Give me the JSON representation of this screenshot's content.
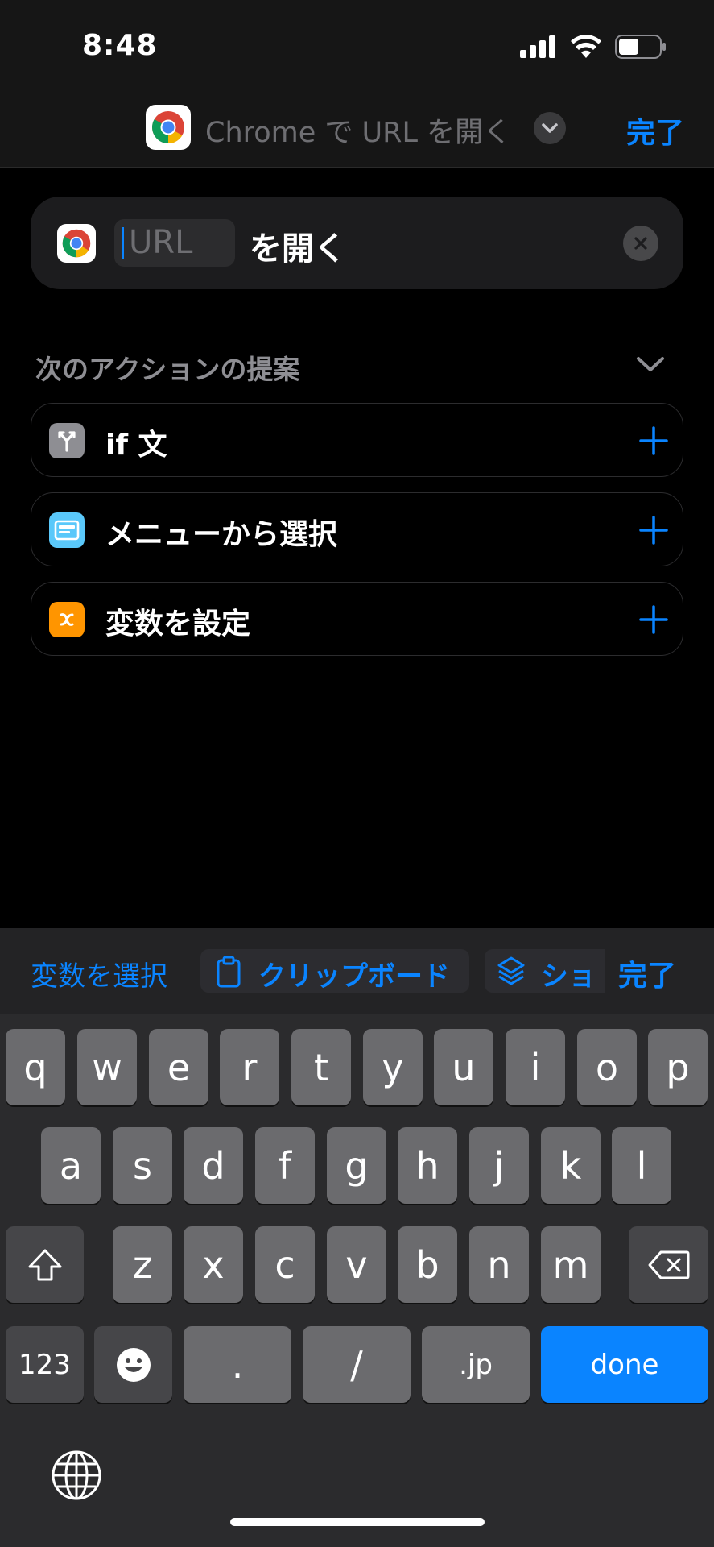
{
  "status_bar": {
    "time": "8:48"
  },
  "nav": {
    "title": "Chrome で URL を開く",
    "done_label": "完了"
  },
  "action": {
    "placeholder": "URL",
    "suffix": "を開く"
  },
  "suggestions": {
    "header": "次のアクションの提案",
    "items": [
      {
        "label": "if 文",
        "icon": "branch-icon",
        "color": "#8e8e93"
      },
      {
        "label": "メニューから選択",
        "icon": "menu-icon",
        "color": "#5ac8fa"
      },
      {
        "label": "変数を設定",
        "icon": "variable-x-icon",
        "color": "#ff9500"
      }
    ]
  },
  "accessory": {
    "select_variable": "変数を選択",
    "clipboard": "クリップボード",
    "shortcut": "ショ",
    "done": "完了"
  },
  "keyboard": {
    "row1": [
      "q",
      "w",
      "e",
      "r",
      "t",
      "y",
      "u",
      "i",
      "o",
      "p"
    ],
    "row2": [
      "a",
      "s",
      "d",
      "f",
      "g",
      "h",
      "j",
      "k",
      "l"
    ],
    "row3": [
      "z",
      "x",
      "c",
      "v",
      "b",
      "n",
      "m"
    ],
    "numbers": "123",
    "dot": ".",
    "slash": "/",
    "jp": ".jp",
    "done": "done"
  },
  "colors": {
    "accent": "#0a84ff",
    "background": "#000000",
    "card": "#1c1c1e"
  }
}
